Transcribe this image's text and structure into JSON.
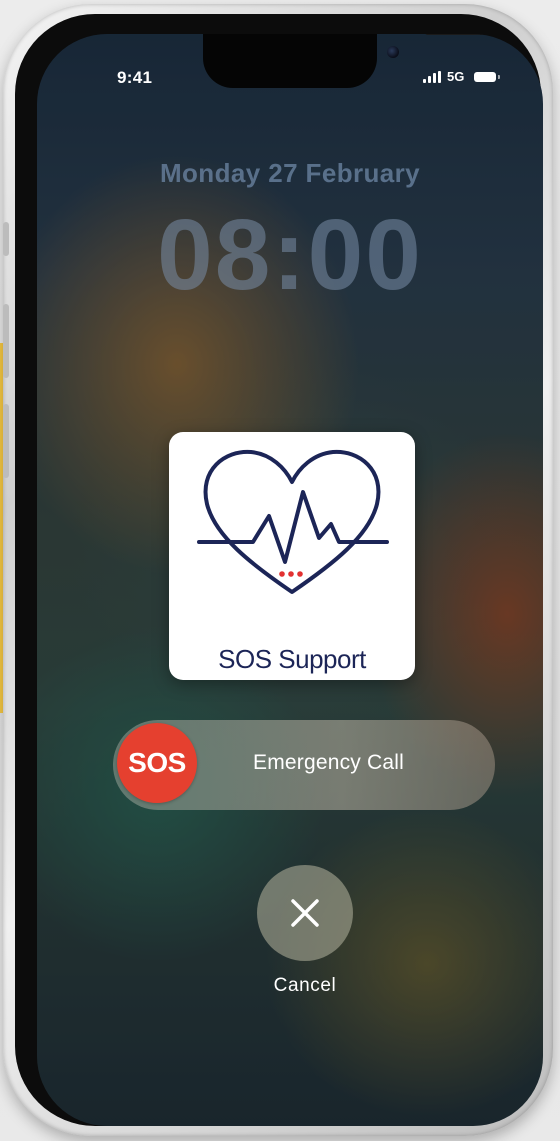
{
  "status_bar": {
    "time": "9:41",
    "network": "5G",
    "signal_icon": "signal-bars-icon",
    "battery_icon": "battery-icon"
  },
  "lock_screen": {
    "date": "Monday 27 February",
    "time": "08:00"
  },
  "app_card": {
    "icon": "heart-pulse-icon",
    "name": "SOS Support",
    "icon_color": "#1c2557",
    "accent_color": "#e23131"
  },
  "sos_slider": {
    "knob_label": "SOS",
    "label": "Emergency Call",
    "knob_color": "#e5402f"
  },
  "cancel": {
    "icon": "close-icon",
    "label": "Cancel"
  },
  "colors": {
    "accent_yellow": "#f6c843"
  }
}
